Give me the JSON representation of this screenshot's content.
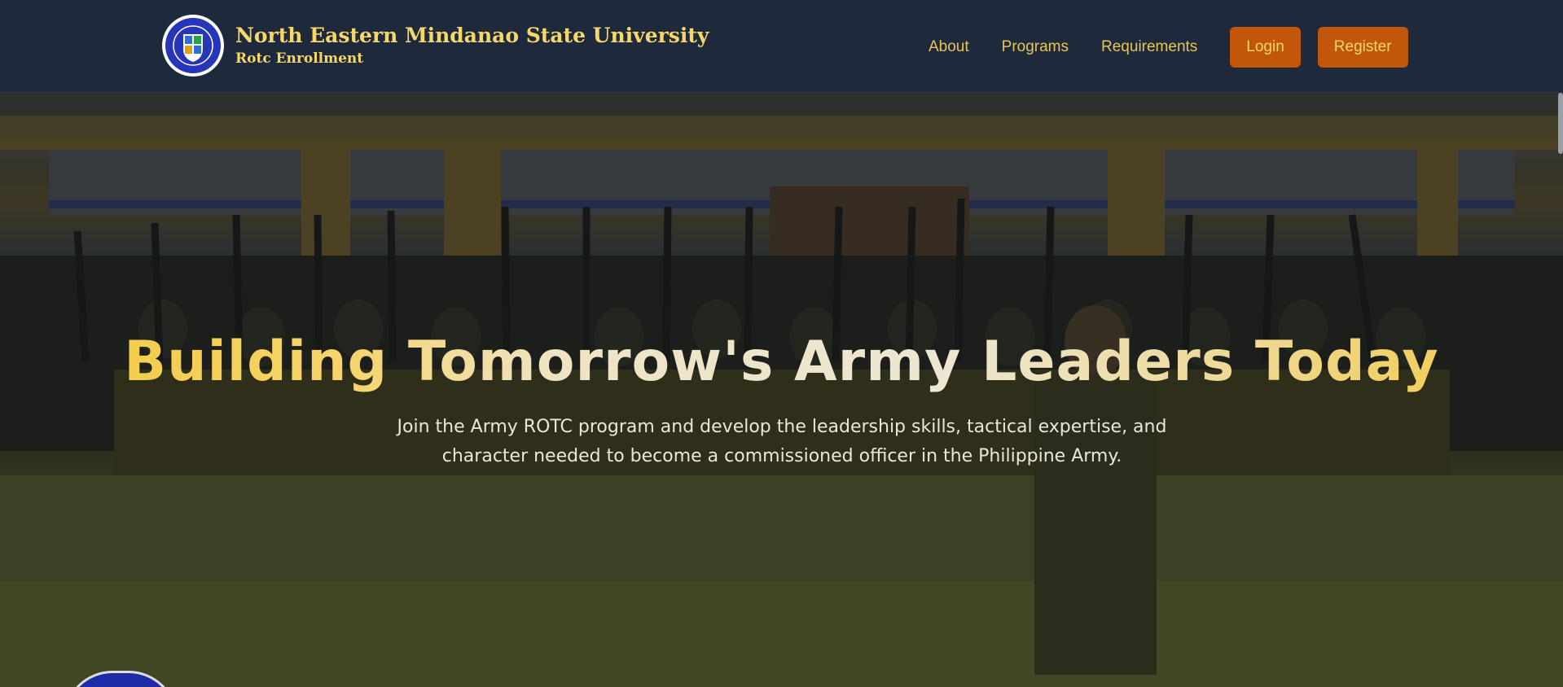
{
  "header": {
    "title": "North Eastern Mindanao State University",
    "subtitle": "Rotc Enrollment",
    "logo_icon": "university-seal-icon",
    "nav_links": [
      "About",
      "Programs",
      "Requirements"
    ],
    "login_label": "Login",
    "register_label": "Register",
    "colors": {
      "navbar_bg": "#1e293b",
      "brand_text": "#f6d76a",
      "nav_link": "#e8c452",
      "button_bg": "#c2560b"
    }
  },
  "hero": {
    "title": "Building Tomorrow's Army Leaders Today",
    "description": "Join the Army ROTC program and develop the leadership skills, tactical expertise, and character needed to become a commissioned officer in the Philippine Army.",
    "background": "cadets-marching-photo"
  }
}
